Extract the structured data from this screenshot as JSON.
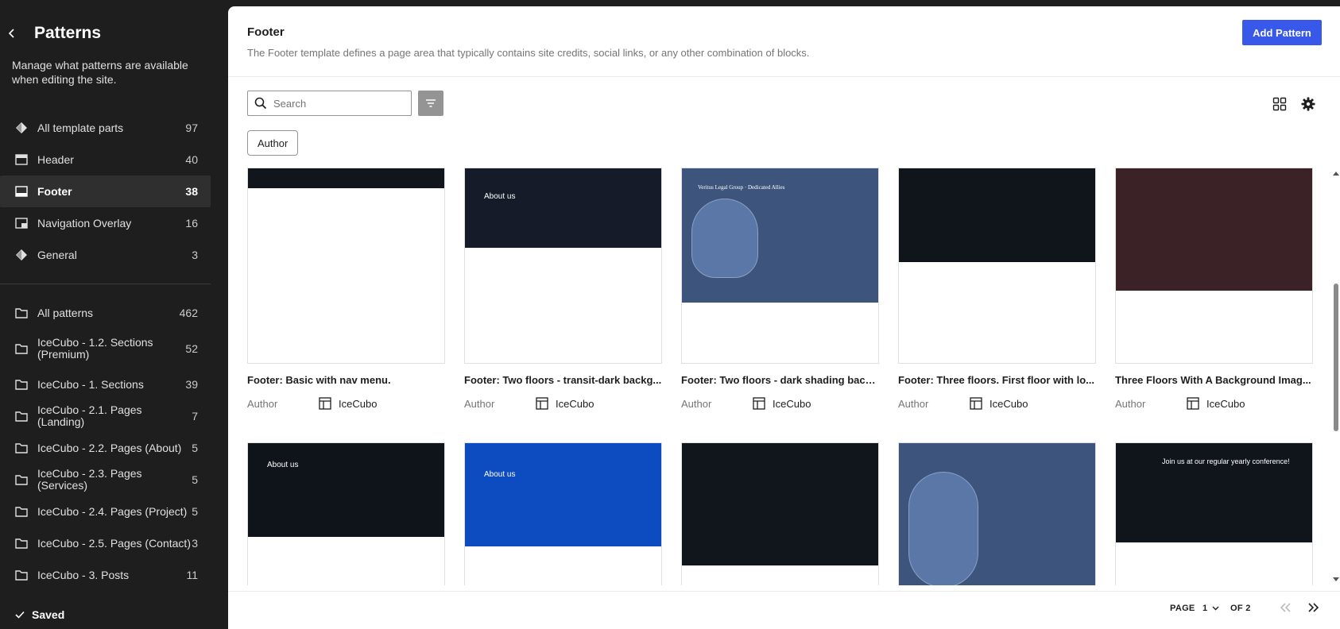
{
  "sidebar": {
    "title": "Patterns",
    "description": "Manage what patterns are available when editing the site.",
    "template_parts": [
      {
        "label": "All template parts",
        "count": "97",
        "icon": "diamond-icon"
      },
      {
        "label": "Header",
        "count": "40",
        "icon": "header-icon"
      },
      {
        "label": "Footer",
        "count": "38",
        "icon": "footer-icon",
        "active": true
      },
      {
        "label": "Navigation Overlay",
        "count": "16",
        "icon": "navigation-overlay-icon"
      },
      {
        "label": "General",
        "count": "3",
        "icon": "diamond-icon"
      }
    ],
    "categories": [
      {
        "label": "All patterns",
        "count": "462"
      },
      {
        "label": "IceCubo - 1.2. Sections (Premium)",
        "count": "52"
      },
      {
        "label": "IceCubo - 1. Sections",
        "count": "39"
      },
      {
        "label": "IceCubo - 2.1. Pages (Landing)",
        "count": "7"
      },
      {
        "label": "IceCubo - 2.2. Pages (About)",
        "count": "5"
      },
      {
        "label": "IceCubo - 2.3. Pages (Services)",
        "count": "5"
      },
      {
        "label": "IceCubo - 2.4. Pages (Project)",
        "count": "5"
      },
      {
        "label": "IceCubo - 2.5. Pages (Contact)",
        "count": "3"
      },
      {
        "label": "IceCubo - 3. Posts",
        "count": "11"
      }
    ],
    "saved_label": "Saved"
  },
  "header": {
    "title": "Footer",
    "description": "The Footer template defines a page area that typically contains site credits, social links, or any other combination of blocks.",
    "add_label": "Add Pattern"
  },
  "toolbar": {
    "search_placeholder": "Search",
    "author_chip": "Author"
  },
  "cards": [
    {
      "title": "Footer: Basic with nav menu.",
      "author_label": "Author",
      "author": "IceCubo",
      "bg": "#11151c",
      "thumb_h": 0.1
    },
    {
      "title": "Footer: Two floors - transit-dark backg...",
      "author_label": "Author",
      "author": "IceCubo",
      "bg": "#151b28",
      "thumb_h": 0.41,
      "heading": "About us"
    },
    {
      "title": "Footer: Two floors - dark shading back...",
      "author_label": "Author",
      "author": "IceCubo",
      "bg": "#3d557c",
      "thumb_h": 0.69,
      "heading": "Veritus Legal Group · Dedicated Allies"
    },
    {
      "title": "Footer: Three floors. First floor with lo...",
      "author_label": "Author",
      "author": "IceCubo",
      "bg": "#10141b",
      "thumb_h": 0.48
    },
    {
      "title": "Three Floors With A Background Imag...",
      "author_label": "Author",
      "author": "IceCubo",
      "bg": "#3a2226",
      "thumb_h": 0.63
    },
    {
      "bg": "#0f131a",
      "thumb_h": 0.48,
      "heading": "About us"
    },
    {
      "bg": "#0d4cc0",
      "thumb_h": 0.53,
      "heading": "About us"
    },
    {
      "bg": "#11151c",
      "thumb_h": 0.63
    },
    {
      "bg": "#3d557c",
      "thumb_h": 0.9
    },
    {
      "bg": "#10141b",
      "thumb_h": 0.51,
      "heading": "Join us at our regular yearly conference!"
    }
  ],
  "pagination": {
    "page_label": "PAGE",
    "current": "1",
    "of_label": "OF 2"
  }
}
